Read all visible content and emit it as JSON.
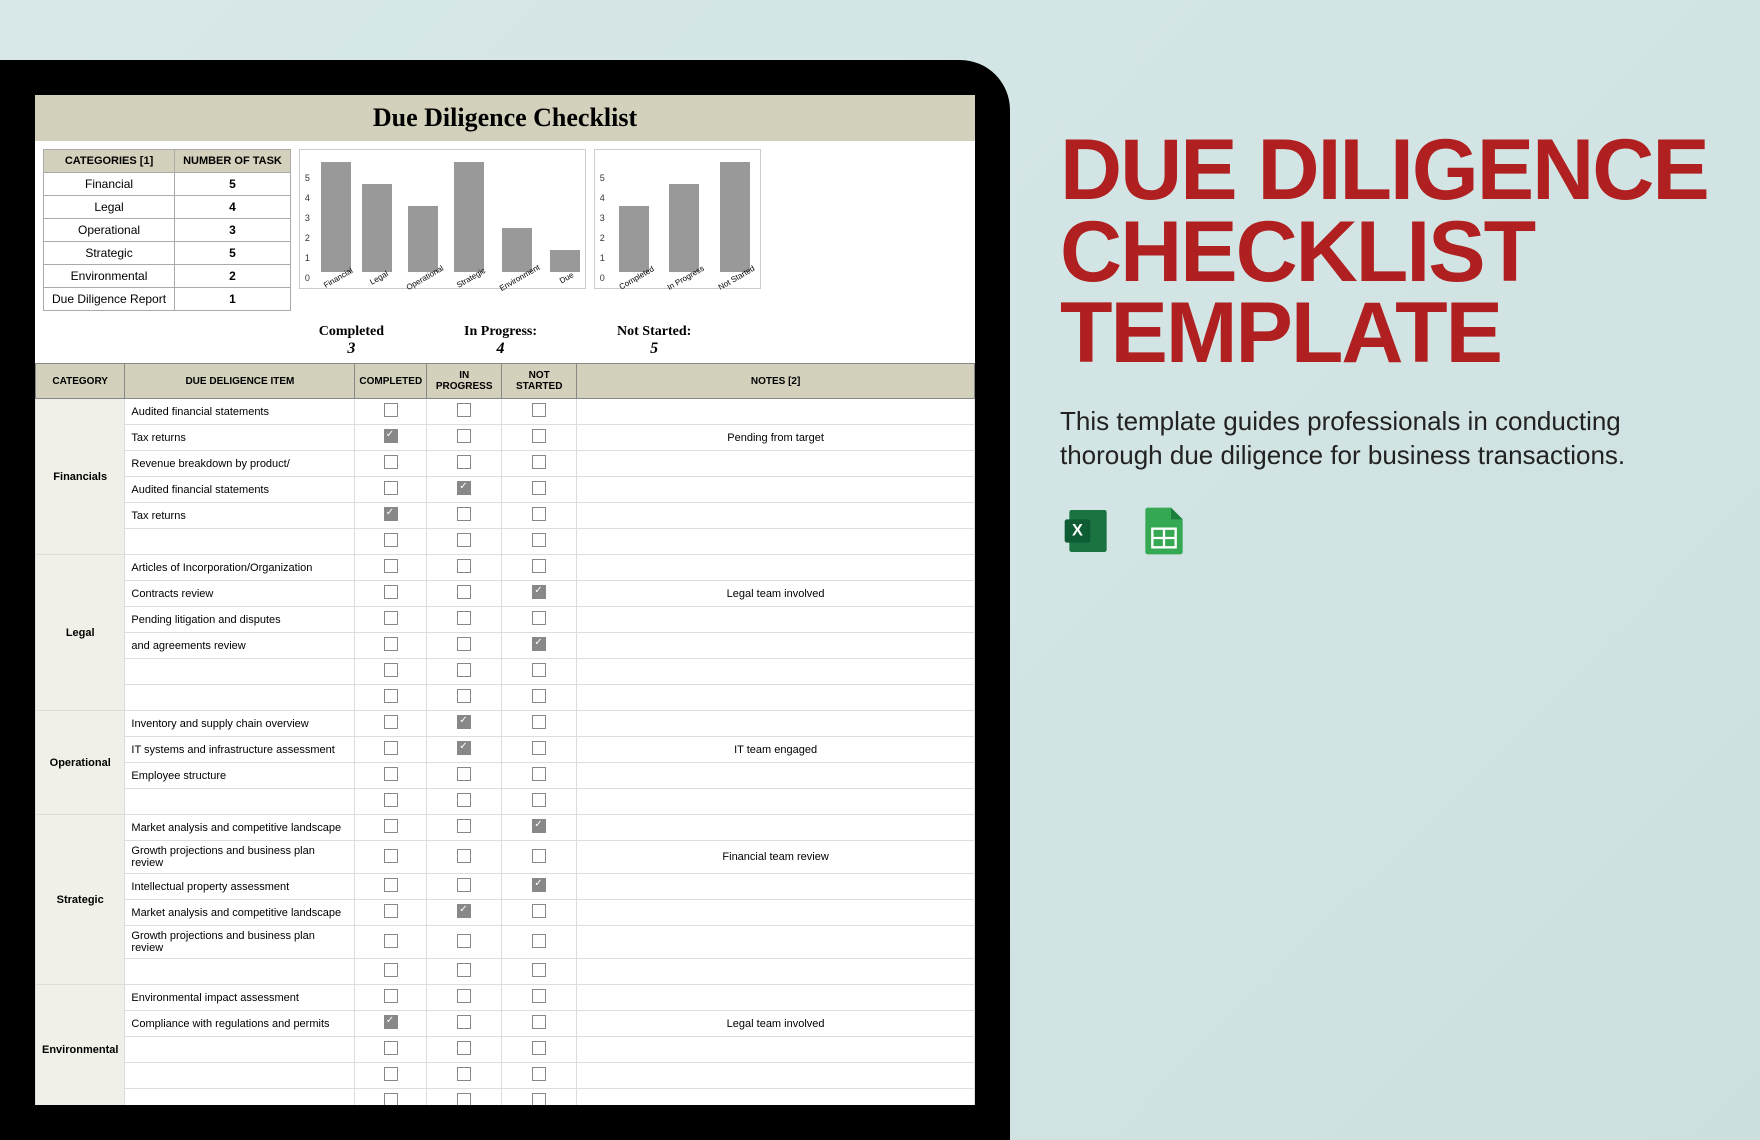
{
  "document_title": "Due Diligence Checklist",
  "headline": "DUE DILIGENCE CHECKLIST TEMPLATE",
  "description": "This template guides professionals in conducting thorough due diligence for business transactions.",
  "summary_headers": {
    "categories": "CATEGORIES [1]",
    "number": "NUMBER OF TASK"
  },
  "summary": [
    {
      "category": "Financial",
      "count": "5"
    },
    {
      "category": "Legal",
      "count": "4"
    },
    {
      "category": "Operational",
      "count": "3"
    },
    {
      "category": "Strategic",
      "count": "5"
    },
    {
      "category": "Environmental",
      "count": "2"
    },
    {
      "category": "Due Diligence Report",
      "count": "1"
    }
  ],
  "chart_data": [
    {
      "type": "bar",
      "categories": [
        "Financial",
        "Legal",
        "Operational",
        "Strategic",
        "Environment",
        "Due"
      ],
      "values": [
        5,
        4,
        3,
        5,
        2,
        1
      ],
      "ylim": [
        0,
        5
      ],
      "title": "",
      "xlabel": "",
      "ylabel": ""
    },
    {
      "type": "bar",
      "categories": [
        "Completed",
        "In Progress",
        "Not Started"
      ],
      "values": [
        3,
        4,
        5
      ],
      "ylim": [
        0,
        5
      ],
      "title": "",
      "xlabel": "",
      "ylabel": ""
    }
  ],
  "status": {
    "completed": {
      "label": "Completed",
      "value": "3"
    },
    "in_progress": {
      "label": "In Progress:",
      "value": "4"
    },
    "not_started": {
      "label": "Not Started:",
      "value": "5"
    }
  },
  "table_headers": {
    "category": "CATEGORY",
    "item": "DUE DELIGENCE ITEM",
    "completed": "COMPLETED",
    "in_progress": "IN PROGRESS",
    "not_started": "NOT STARTED",
    "notes": "NOTES [2]"
  },
  "sections": [
    {
      "category": "Financials",
      "rows": [
        {
          "item": "Audited financial statements",
          "completed": false,
          "in_progress": false,
          "not_started": false,
          "notes": ""
        },
        {
          "item": "Tax returns",
          "completed": true,
          "in_progress": false,
          "not_started": false,
          "notes": "Pending from target"
        },
        {
          "item": "Revenue breakdown by product/",
          "completed": false,
          "in_progress": false,
          "not_started": false,
          "notes": ""
        },
        {
          "item": "Audited financial statements",
          "completed": false,
          "in_progress": true,
          "not_started": false,
          "notes": ""
        },
        {
          "item": "Tax returns",
          "completed": true,
          "in_progress": false,
          "not_started": false,
          "notes": ""
        },
        {
          "item": "",
          "completed": false,
          "in_progress": false,
          "not_started": false,
          "notes": ""
        }
      ]
    },
    {
      "category": "Legal",
      "rows": [
        {
          "item": "Articles of Incorporation/Organization",
          "completed": false,
          "in_progress": false,
          "not_started": false,
          "notes": ""
        },
        {
          "item": "Contracts review",
          "completed": false,
          "in_progress": false,
          "not_started": true,
          "notes": "Legal team involved"
        },
        {
          "item": "Pending litigation and disputes",
          "completed": false,
          "in_progress": false,
          "not_started": false,
          "notes": ""
        },
        {
          "item": "and agreements review",
          "completed": false,
          "in_progress": false,
          "not_started": true,
          "notes": ""
        },
        {
          "item": "",
          "completed": false,
          "in_progress": false,
          "not_started": false,
          "notes": ""
        },
        {
          "item": "",
          "completed": false,
          "in_progress": false,
          "not_started": false,
          "notes": ""
        }
      ]
    },
    {
      "category": "Operational",
      "rows": [
        {
          "item": "Inventory and supply chain overview",
          "completed": false,
          "in_progress": true,
          "not_started": false,
          "notes": ""
        },
        {
          "item": "IT systems and infrastructure assessment",
          "completed": false,
          "in_progress": true,
          "not_started": false,
          "notes": "IT team engaged"
        },
        {
          "item": "Employee structure",
          "completed": false,
          "in_progress": false,
          "not_started": false,
          "notes": ""
        },
        {
          "item": "",
          "completed": false,
          "in_progress": false,
          "not_started": false,
          "notes": ""
        }
      ]
    },
    {
      "category": "Strategic",
      "rows": [
        {
          "item": "Market analysis and competitive landscape",
          "completed": false,
          "in_progress": false,
          "not_started": true,
          "notes": ""
        },
        {
          "item": "Growth projections and business plan review",
          "completed": false,
          "in_progress": false,
          "not_started": false,
          "notes": "Financial team review"
        },
        {
          "item": "Intellectual property assessment",
          "completed": false,
          "in_progress": false,
          "not_started": true,
          "notes": ""
        },
        {
          "item": "Market analysis and competitive landscape",
          "completed": false,
          "in_progress": true,
          "not_started": false,
          "notes": ""
        },
        {
          "item": "Growth projections and business plan review",
          "completed": false,
          "in_progress": false,
          "not_started": false,
          "notes": ""
        },
        {
          "item": "",
          "completed": false,
          "in_progress": false,
          "not_started": false,
          "notes": ""
        }
      ]
    },
    {
      "category": "Environmental",
      "rows": [
        {
          "item": "Environmental impact assessment",
          "completed": false,
          "in_progress": false,
          "not_started": false,
          "notes": ""
        },
        {
          "item": "Compliance with regulations and permits",
          "completed": true,
          "in_progress": false,
          "not_started": false,
          "notes": "Legal team involved"
        },
        {
          "item": "",
          "completed": false,
          "in_progress": false,
          "not_started": false,
          "notes": ""
        },
        {
          "item": "",
          "completed": false,
          "in_progress": false,
          "not_started": false,
          "notes": ""
        },
        {
          "item": "",
          "completed": false,
          "in_progress": false,
          "not_started": false,
          "notes": ""
        }
      ]
    }
  ]
}
